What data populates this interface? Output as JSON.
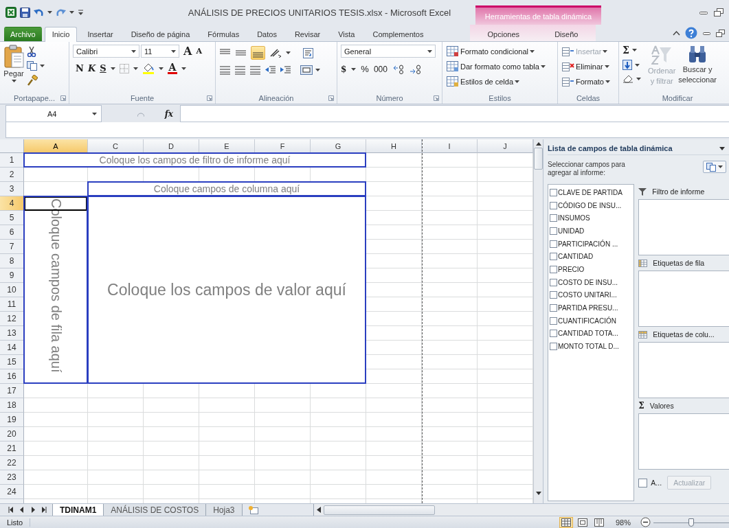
{
  "title_bar": {
    "title": "ANÁLISIS DE PRECIOS UNITARIOS TESIS.xlsx  -  Microsoft Excel",
    "context_group": "Herramientas de tabla dinámica"
  },
  "ribbon_tabs": [
    {
      "label": "Archivo",
      "kind": "file",
      "selected": false
    },
    {
      "label": "Inicio",
      "kind": "standard",
      "selected": true
    },
    {
      "label": "Insertar",
      "kind": "standard",
      "selected": false
    },
    {
      "label": "Diseño de página",
      "kind": "standard",
      "selected": false
    },
    {
      "label": "Fórmulas",
      "kind": "standard",
      "selected": false
    },
    {
      "label": "Datos",
      "kind": "standard",
      "selected": false
    },
    {
      "label": "Revisar",
      "kind": "standard",
      "selected": false
    },
    {
      "label": "Vista",
      "kind": "standard",
      "selected": false
    },
    {
      "label": "Complementos",
      "kind": "standard",
      "selected": false
    },
    {
      "label": "Opciones",
      "kind": "context",
      "selected": false
    },
    {
      "label": "Diseño",
      "kind": "context",
      "selected": false
    }
  ],
  "ribbon": {
    "clipboard": {
      "paste": "Pegar",
      "label": "Portapape..."
    },
    "font": {
      "name": "Calibri",
      "size": "11",
      "grow": "A",
      "shrink": "A",
      "bold": "N",
      "italic": "K",
      "underline": "S",
      "font_color_letter": "A",
      "label": "Fuente"
    },
    "alignment": {
      "label": "Alineación"
    },
    "number": {
      "format": "General",
      "currency": "$",
      "percent": "%",
      "thousands": "000",
      "label": "Número"
    },
    "styles": {
      "items": [
        "Formato condicional",
        "Dar formato como tabla",
        "Estilos de celda"
      ],
      "label": "Estilos"
    },
    "cells": {
      "items": [
        {
          "label": "Insertar",
          "disabled": true
        },
        {
          "label": "Eliminar",
          "disabled": false
        },
        {
          "label": "Formato",
          "disabled": false
        }
      ],
      "label": "Celdas"
    },
    "editing": {
      "autosum": "Σ",
      "sort": {
        "lines": [
          "Ordenar",
          "y filtrar"
        ],
        "disabled": true
      },
      "find": {
        "lines": [
          "Buscar y",
          "seleccionar"
        ],
        "disabled": false
      },
      "label": "Modificar"
    }
  },
  "formula_bar": {
    "name_box": "A4",
    "function_symbol": "fx"
  },
  "columns": [
    {
      "label": "A",
      "selected": true
    },
    {
      "label": "C",
      "selected": false
    },
    {
      "label": "D",
      "selected": false
    },
    {
      "label": "E",
      "selected": false
    },
    {
      "label": "F",
      "selected": false
    },
    {
      "label": "G",
      "selected": false
    },
    {
      "label": "H",
      "selected": false
    },
    {
      "label": "I",
      "selected": false
    },
    {
      "label": "J",
      "selected": false
    }
  ],
  "rows": [
    {
      "label": "1",
      "selected": false
    },
    {
      "label": "2",
      "selected": false
    },
    {
      "label": "3",
      "selected": false
    },
    {
      "label": "4",
      "selected": true
    },
    {
      "label": "5",
      "selected": false
    },
    {
      "label": "6",
      "selected": false
    },
    {
      "label": "7",
      "selected": false
    },
    {
      "label": "8",
      "selected": false
    },
    {
      "label": "9",
      "selected": false
    },
    {
      "label": "10",
      "selected": false
    },
    {
      "label": "11",
      "selected": false
    },
    {
      "label": "12",
      "selected": false
    },
    {
      "label": "13",
      "selected": false
    },
    {
      "label": "14",
      "selected": false
    },
    {
      "label": "15",
      "selected": false
    },
    {
      "label": "16",
      "selected": false
    },
    {
      "label": "17",
      "selected": false
    },
    {
      "label": "18",
      "selected": false
    },
    {
      "label": "19",
      "selected": false
    },
    {
      "label": "20",
      "selected": false
    },
    {
      "label": "21",
      "selected": false
    },
    {
      "label": "22",
      "selected": false
    },
    {
      "label": "23",
      "selected": false
    },
    {
      "label": "24",
      "selected": false
    }
  ],
  "pivot_drop_zones": [
    {
      "kind": "filter",
      "text": "Coloque los campos de filtro de informe aquí"
    },
    {
      "kind": "column",
      "text": "Coloque campos de columna aquí"
    },
    {
      "kind": "row",
      "text": "Coloque campos de fila aquí"
    },
    {
      "kind": "value",
      "text": "Coloque los campos de valor aquí"
    }
  ],
  "field_list": {
    "title": "Lista de campos de tabla dinámica",
    "prompt": "Seleccionar campos para agregar al informe:",
    "fields": [
      {
        "label": "CLAVE DE PARTIDA",
        "checked": false
      },
      {
        "label": "CÓDIGO DE INSU...",
        "checked": false
      },
      {
        "label": "INSUMOS",
        "checked": false
      },
      {
        "label": "UNIDAD",
        "checked": false
      },
      {
        "label": "PARTICIPACIÓN ...",
        "checked": false
      },
      {
        "label": "CANTIDAD",
        "checked": false
      },
      {
        "label": "PRECIO",
        "checked": false
      },
      {
        "label": "COSTO DE INSU...",
        "checked": false
      },
      {
        "label": "COSTO UNITARI...",
        "checked": false
      },
      {
        "label": "PARTIDA PRESU...",
        "checked": false
      },
      {
        "label": "CUANTIFICACIÓN",
        "checked": false
      },
      {
        "label": "CANTIDAD TOTA...",
        "checked": false
      },
      {
        "label": "MONTO TOTAL D...",
        "checked": false
      }
    ],
    "areas": [
      {
        "kind": "filter",
        "label": "Filtro de informe"
      },
      {
        "kind": "rows",
        "label": "Etiquetas de fila"
      },
      {
        "kind": "columns",
        "label": "Etiquetas de colu..."
      },
      {
        "kind": "values",
        "label": "Valores",
        "symbol": "Σ"
      }
    ],
    "defer": {
      "label": "A...",
      "checked": false
    },
    "update_button": {
      "label": "Actualizar",
      "disabled": true
    }
  },
  "sheet_tabs": [
    {
      "label": "TDINAM1",
      "selected": true
    },
    {
      "label": "ANÁLISIS DE COSTOS",
      "selected": false
    },
    {
      "label": "Hoja3",
      "selected": false
    }
  ],
  "status_bar": {
    "status": "Listo",
    "zoom": "98%",
    "zoom_slider": {
      "level": 0.5
    }
  }
}
